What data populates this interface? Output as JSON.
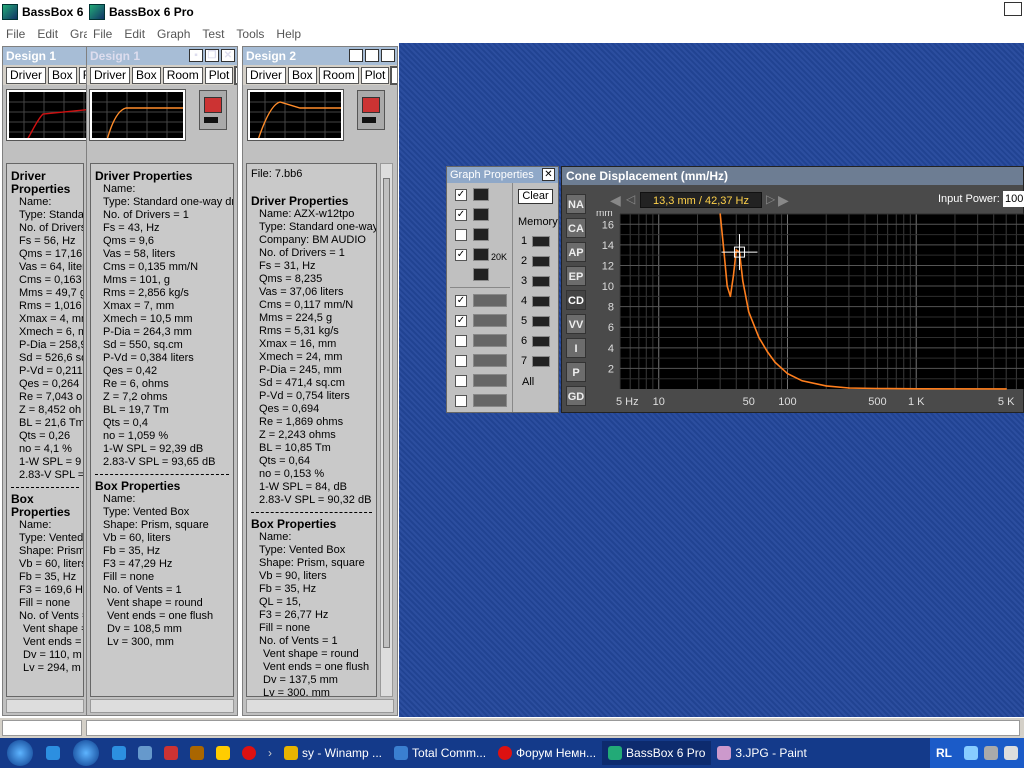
{
  "titles": {
    "app1": "BassBox 6",
    "app2": "BassBox 6 Pro"
  },
  "menu1": [
    "File",
    "Edit",
    "Grap"
  ],
  "menu2": [
    "File",
    "Edit",
    "Graph",
    "Test",
    "Tools",
    "Help"
  ],
  "tabs": {
    "driver": "Driver",
    "box": "Box",
    "room": "Room",
    "plot": "Plot",
    "room_short": "Ro"
  },
  "design1": {
    "title": "Design 1",
    "driver_header": "Driver Properties",
    "driver": [
      "Name:",
      "Type: Standard",
      "No. of Drivers",
      "Fs = 56, Hz",
      "Qms = 17,16",
      "Vas = 64, liter",
      "Cms = 0,163",
      "Mms = 49,7 g",
      "Rms = 1,016",
      "Xmax = 4, mm",
      "Xmech = 6, m",
      "P-Dia = 258,9",
      "Sd = 526,6 sq",
      "P-Vd = 0,211",
      "Qes = 0,264",
      "Re = 7,043 o",
      "Z = 8,452 oh",
      "BL = 21,6 Tm",
      "Qts = 0,26",
      "no = 4,1 %",
      "1-W SPL = 9",
      "2.83-V SPL ="
    ],
    "box_header": "Box Properties",
    "box": [
      "Name:",
      "Type: Vented",
      "Shape: Prism,",
      "Vb = 60, liters",
      "Fb = 35, Hz",
      "F3 = 169,6 H",
      "Fill = none",
      "No. of Vents ="
    ],
    "box2": [
      "Vent shape =",
      "Vent ends =",
      "Dv = 110, m",
      "Lv = 294, m"
    ]
  },
  "design1b": {
    "title": "Design 1",
    "driver_header": "Driver Properties",
    "driver": [
      "Name:",
      "Type: Standard one-way driv",
      "No. of Drivers = 1",
      "Fs = 43, Hz",
      "Qms = 9,6",
      "Vas = 58, liters",
      "Cms = 0,135 mm/N",
      "Mms = 101, g",
      "Rms = 2,856 kg/s",
      "Xmax = 7, mm",
      "Xmech = 10,5 mm",
      "P-Dia = 264,3 mm",
      "Sd = 550, sq.cm",
      "P-Vd = 0,384 liters",
      "Qes = 0,42",
      "Re = 6, ohms",
      "Z = 7,2 ohms",
      "BL = 19,7 Tm",
      "Qts = 0,4",
      "no = 1,059 %",
      "1-W SPL = 92,39 dB",
      "2.83-V SPL = 93,65 dB"
    ],
    "box_header": "Box Properties",
    "box": [
      "Name:",
      "Type: Vented Box",
      "Shape: Prism, square",
      "Vb = 60, liters",
      "Fb = 35, Hz",
      "F3 = 47,29 Hz",
      "Fill = none",
      "No. of Vents = 1"
    ],
    "box2": [
      "Vent shape = round",
      "Vent ends = one flush",
      "Dv = 108,5 mm",
      "Lv = 300, mm"
    ]
  },
  "design2": {
    "title": "Design 2",
    "file": "File: 7.bb6",
    "driver_header": "Driver Properties",
    "driver": [
      "Name: AZX-w12tpo",
      "Type: Standard one-way d",
      "Company: BM AUDIO",
      "No. of Drivers = 1",
      "Fs = 31, Hz",
      "Qms = 8,235",
      "Vas = 37,06 liters",
      "Cms = 0,117 mm/N",
      "Mms = 224,5 g",
      "Rms = 5,31 kg/s",
      "Xmax = 16, mm",
      "Xmech = 24, mm",
      "P-Dia = 245, mm",
      "Sd = 471,4 sq.cm",
      "P-Vd = 0,754 liters",
      "Qes = 0,694",
      "Re = 1,869 ohms",
      "Z = 2,243 ohms",
      "BL = 10,85 Tm",
      "Qts = 0,64",
      "no = 0,153 %",
      "1-W SPL = 84, dB",
      "2.83-V SPL = 90,32 dB"
    ],
    "box_header": "Box Properties",
    "box": [
      "Name:",
      "Type: Vented Box",
      "Shape: Prism, square",
      "Vb = 90, liters",
      "Fb = 35, Hz",
      "QL = 15,",
      "F3 = 26,77 Hz",
      "Fill = none",
      "No. of Vents = 1"
    ],
    "box2": [
      "Vent shape = round",
      "Vent ends = one flush",
      "Dv = 137,5 mm",
      "Lv = 300, mm"
    ]
  },
  "graph_props": {
    "title": "Graph Properties",
    "clear": "Clear",
    "memory": "Memory",
    "mem_slots": [
      "1",
      "2",
      "3",
      "4",
      "5",
      "6",
      "7"
    ],
    "all": "All",
    "twentyk": "20K"
  },
  "cone": {
    "title": "Cone Displacement (mm/Hz)",
    "readout": "13,3 mm / 42,37 Hz",
    "input_power_label": "Input Power:",
    "input_power_value": "100",
    "tabs": [
      "NA",
      "CA",
      "AP",
      "EP",
      "CD",
      "VV",
      "I",
      "P",
      "GD"
    ],
    "y_unit": "mm",
    "y_ticks": [
      "16",
      "14",
      "12",
      "10",
      "8",
      "6",
      "4",
      "2"
    ],
    "x_ticks": [
      "5 Hz",
      "10",
      "50",
      "100",
      "500",
      "1 K",
      "5 K"
    ]
  },
  "chart_data": {
    "type": "line",
    "title": "Cone Displacement (mm/Hz)",
    "xlabel": "",
    "ylabel": "mm",
    "xscale": "log",
    "ylim": [
      0,
      17
    ],
    "x": [
      30,
      32,
      34,
      36,
      38,
      40,
      42.37,
      45,
      50,
      60,
      70,
      80,
      100,
      130,
      200,
      300,
      500,
      1000,
      5000
    ],
    "y": [
      17,
      13.5,
      10,
      9,
      11,
      13.5,
      13.3,
      10.5,
      7.5,
      5,
      3.6,
      2.6,
      1.5,
      0.8,
      0.3,
      0.1,
      0.05,
      0.02,
      0.01
    ]
  },
  "taskbar": [
    "sy - Winamp ...",
    "Total Comm...",
    "Форум Немн...",
    "BassBox 6 Pro",
    "3.JPG - Paint"
  ],
  "tray": {
    "lang": "RL"
  },
  "colors": {
    "curve": "#ff7f1e",
    "desktop": "#23479b",
    "taskbar": "#143a8a"
  }
}
